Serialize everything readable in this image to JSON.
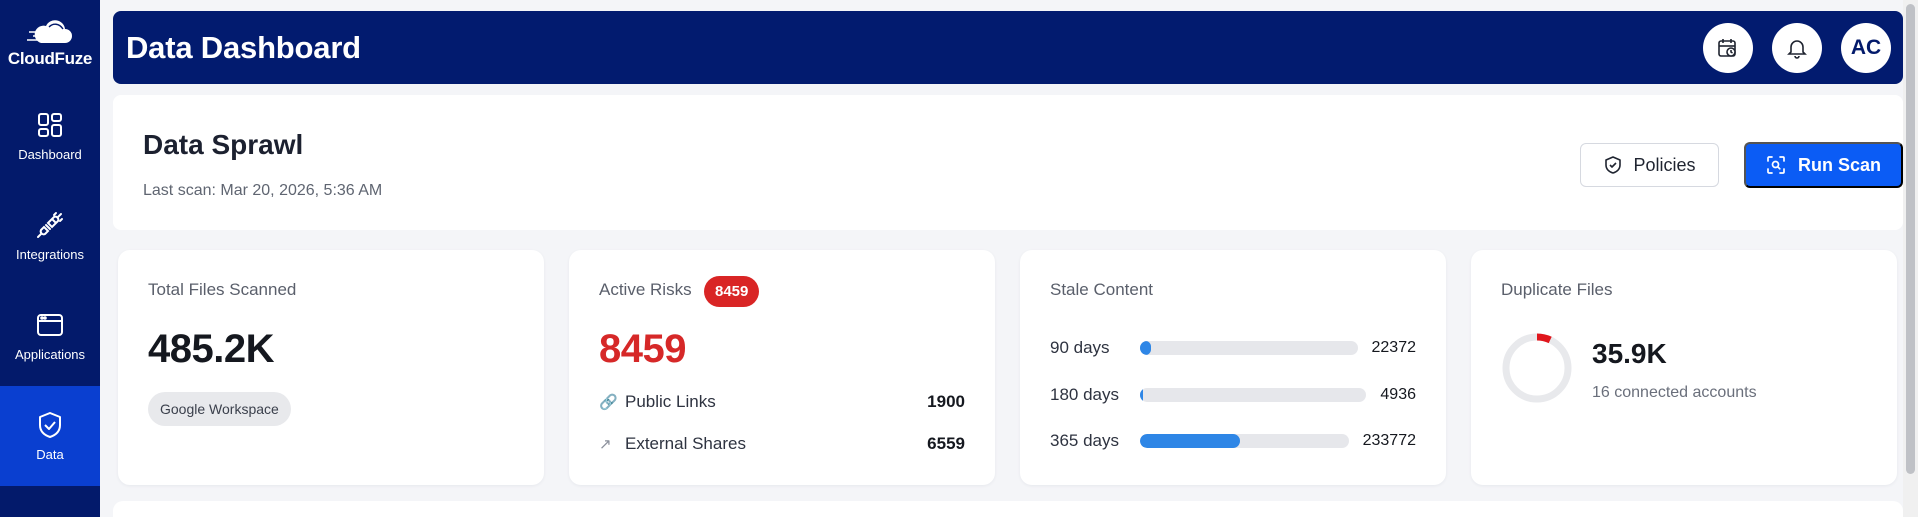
{
  "brand": {
    "name": "CloudFuze"
  },
  "sidebar": {
    "items": [
      {
        "label": "Dashboard",
        "icon": "dashboard-icon"
      },
      {
        "label": "Integrations",
        "icon": "plug-icon"
      },
      {
        "label": "Applications",
        "icon": "window-icon"
      },
      {
        "label": "Data",
        "icon": "shield-check-icon",
        "active": true
      }
    ]
  },
  "header": {
    "title": "Data Dashboard",
    "avatar_initials": "AC"
  },
  "section": {
    "title": "Data Sprawl",
    "last_scan": "Last scan: Mar 20, 2026, 5:36 AM",
    "policies_label": "Policies",
    "run_scan_label": "Run Scan"
  },
  "cards": {
    "total_files": {
      "title": "Total Files Scanned",
      "value": "485.2K",
      "source": "Google Workspace"
    },
    "active_risks": {
      "title": "Active Risks",
      "badge": "8459",
      "value": "8459",
      "rows": [
        {
          "label": "Public Links",
          "value": "1900"
        },
        {
          "label": "External Shares",
          "value": "6559"
        }
      ]
    },
    "stale_content": {
      "title": "Stale Content",
      "rows": [
        {
          "label": "90 days",
          "value": "22372",
          "fill": 0.05
        },
        {
          "label": "180 days",
          "value": "4936",
          "fill": 0.01
        },
        {
          "label": "365 days",
          "value": "233772",
          "fill": 0.48
        }
      ]
    },
    "duplicate_files": {
      "title": "Duplicate Files",
      "value": "35.9K",
      "sub": "16 connected accounts",
      "ring_fill": 0.07
    }
  },
  "colors": {
    "sidebar_bg": "#031a6b",
    "active_nav": "#0a3fd0",
    "primary": "#0b5cf5",
    "risk": "#d92525",
    "bar_fill": "#2e86e6"
  }
}
